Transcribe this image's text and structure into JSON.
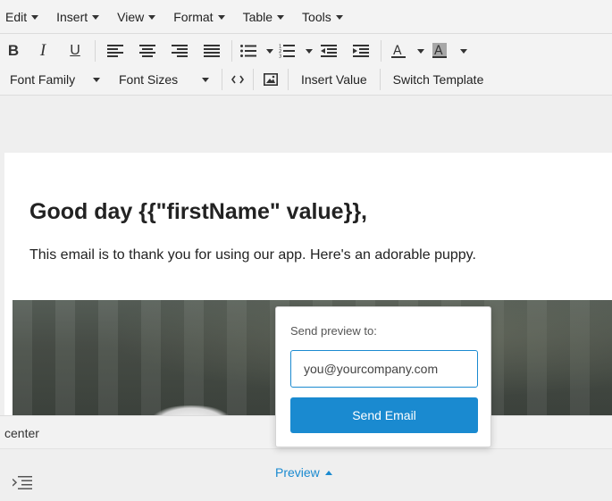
{
  "menubar": {
    "items": [
      {
        "label": "Edit"
      },
      {
        "label": "Insert"
      },
      {
        "label": "View"
      },
      {
        "label": "Format"
      },
      {
        "label": "Table"
      },
      {
        "label": "Tools"
      }
    ]
  },
  "toolbar": {
    "bold_label": "B",
    "italic_label": "I",
    "underline_label": "U",
    "font_family_label": "Font Family",
    "font_sizes_label": "Font Sizes",
    "insert_value_label": "Insert Value",
    "switch_template_label": "Switch Template",
    "icons": [
      "bold-icon",
      "italic-icon",
      "underline-icon",
      "align-left-icon",
      "align-center-icon",
      "align-right-icon",
      "align-justify-icon",
      "bullet-list-icon",
      "numbered-list-icon",
      "outdent-icon",
      "indent-icon",
      "text-color-icon",
      "background-color-icon",
      "source-code-icon",
      "image-icon"
    ]
  },
  "document": {
    "heading": "Good day {{\"firstName\" value}},",
    "body": "This email is to thank you for using our app. Here's an adorable puppy."
  },
  "statusbar": {
    "path": "center"
  },
  "preview": {
    "toggle_label": "Preview",
    "popover": {
      "label": "Send preview to:",
      "input_value": "you@yourcompany.com",
      "button_label": "Send Email"
    }
  },
  "colors": {
    "accent": "#1a8ad0",
    "toolbar_bg": "#f3f3f3",
    "page_bg": "#ffffff"
  }
}
